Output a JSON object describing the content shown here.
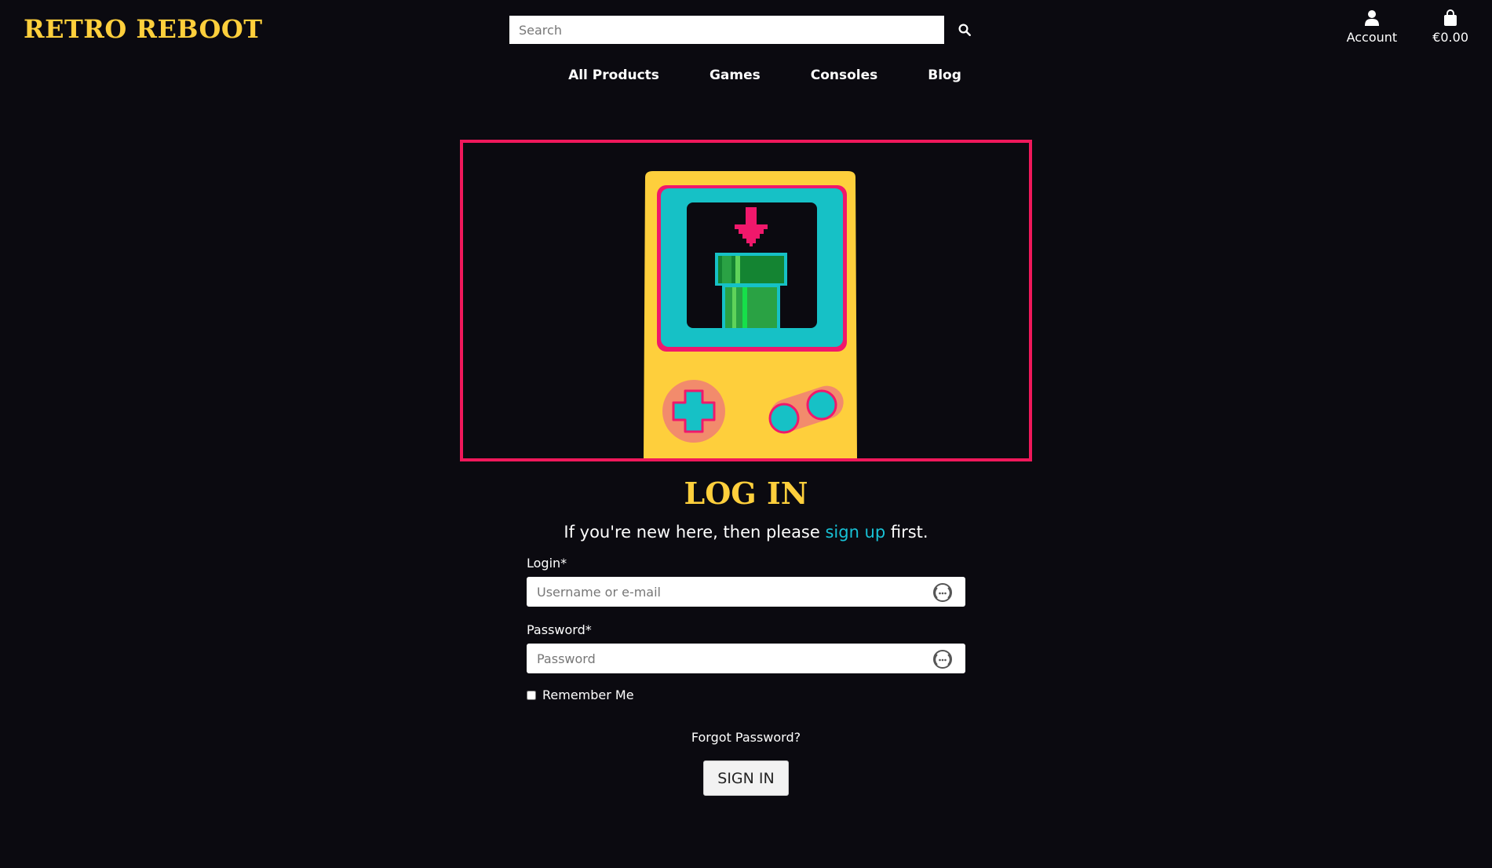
{
  "header": {
    "logo": "RETRO REBOOT",
    "search_placeholder": "Search",
    "account_label": "Account",
    "cart_total": "€0.00"
  },
  "nav": [
    "All Products",
    "Games",
    "Consoles",
    "Blog"
  ],
  "hero": {
    "image": "retro-handheld-console-illustration",
    "border_color": "#f0185b"
  },
  "login": {
    "title": "LOG IN",
    "intro_before": "If you're new here, then please ",
    "intro_link": "sign up",
    "intro_after": " first.",
    "login_label": "Login*",
    "login_placeholder": "Username or e-mail",
    "password_label": "Password*",
    "password_placeholder": "Password",
    "remember_label": "Remember Me",
    "forgot_label": "Forgot Password?",
    "submit_label": "SIGN IN"
  },
  "colors": {
    "background": "#0b0a10",
    "brand_yellow": "#fecf3c",
    "accent_pink": "#f0185b",
    "link_cyan": "#18c2d6"
  },
  "icons": {
    "search": "search-icon",
    "account": "user-icon",
    "cart": "shopping-bag-icon",
    "password_manager": "password-manager-icon"
  }
}
